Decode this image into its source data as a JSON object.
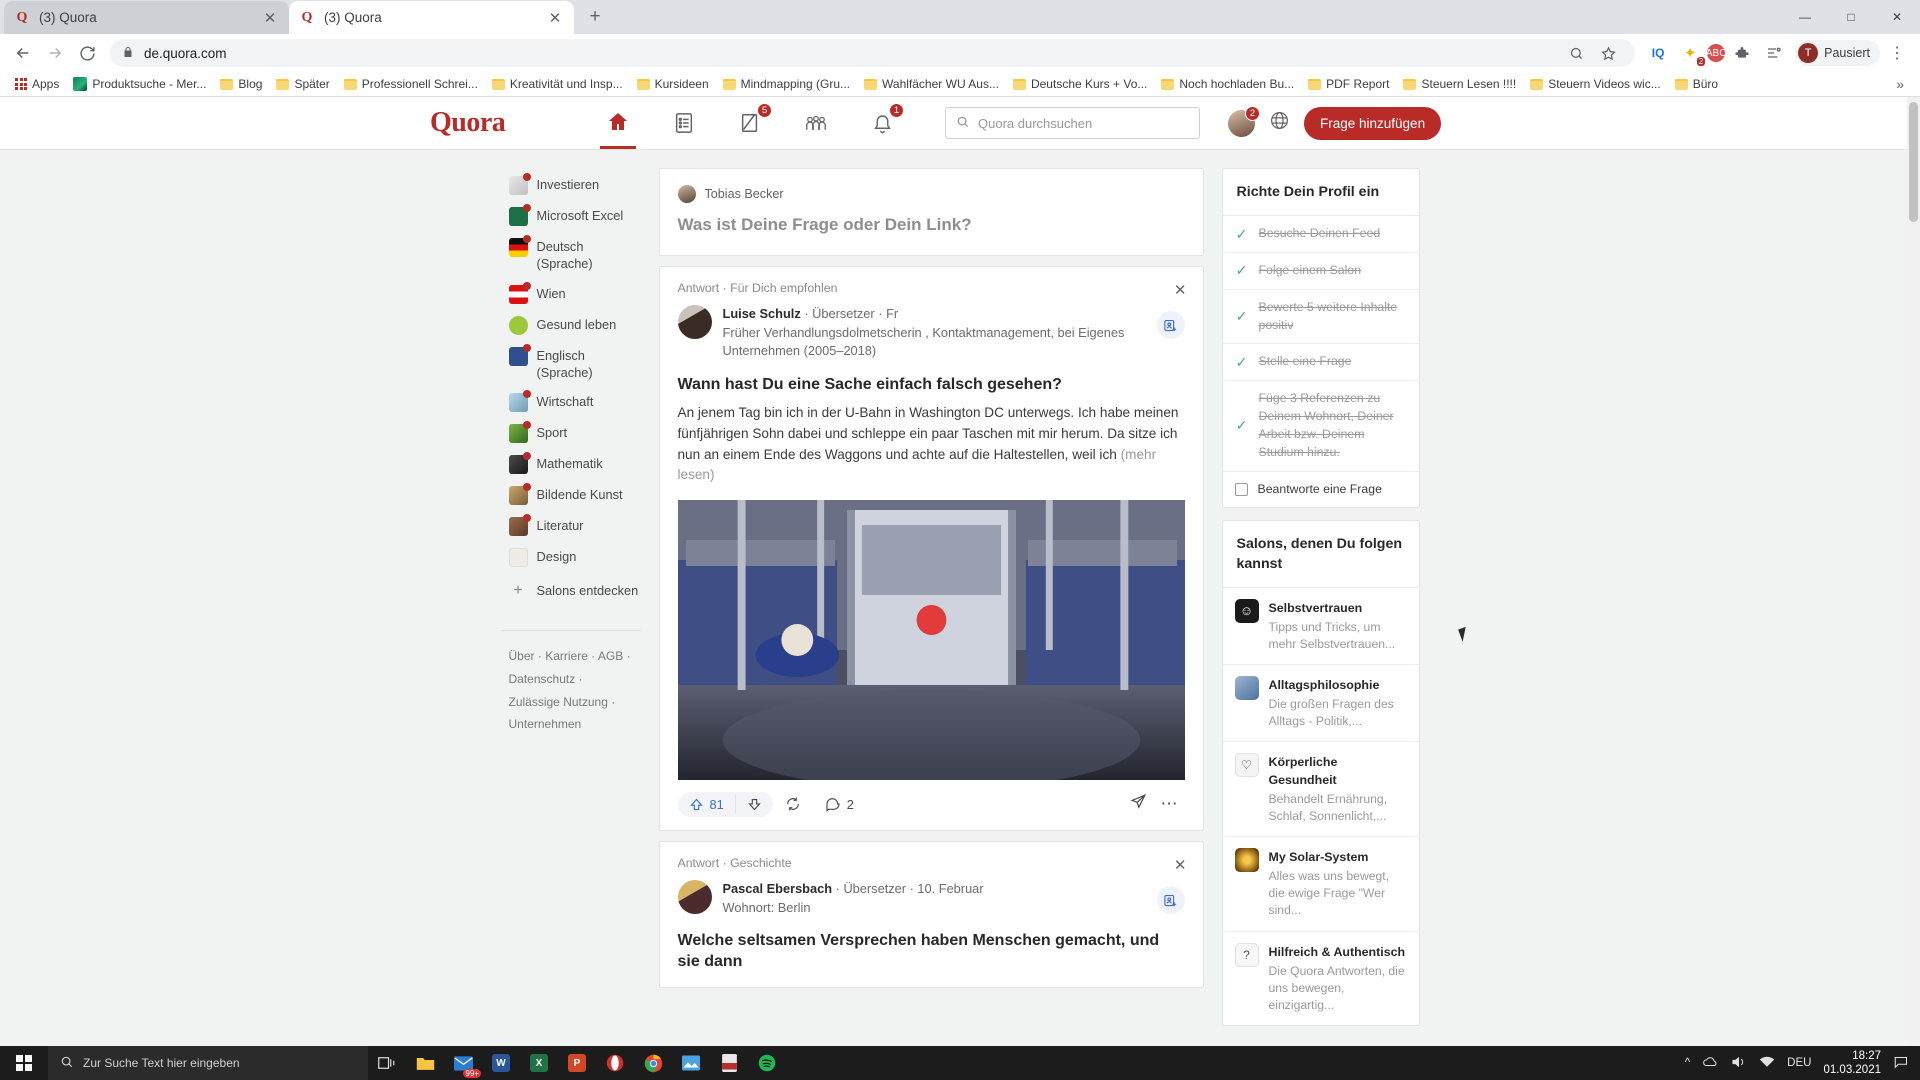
{
  "browser": {
    "tabs": [
      {
        "title": "(3) Quora",
        "favicon": "quora-icon",
        "active": false
      },
      {
        "title": "(3) Quora",
        "favicon": "quora-icon",
        "active": true
      }
    ],
    "newtab_label": "+",
    "window_controls": {
      "minimize": "—",
      "maximize": "□",
      "close": "✕"
    },
    "url": "de.quora.com",
    "profile_label": "Pausiert",
    "profile_initial": "T",
    "bookmarks": [
      {
        "label": "Apps",
        "icon": "apps-grid-icon"
      },
      {
        "label": "Produktsuche - Mer...",
        "icon": "site-icon"
      },
      {
        "label": "Blog",
        "icon": "folder-icon"
      },
      {
        "label": "Später",
        "icon": "folder-icon"
      },
      {
        "label": "Professionell Schrei...",
        "icon": "folder-icon"
      },
      {
        "label": "Kreativität und Insp...",
        "icon": "folder-icon"
      },
      {
        "label": "Kursideen",
        "icon": "folder-icon"
      },
      {
        "label": "Mindmapping  (Gru...",
        "icon": "folder-icon"
      },
      {
        "label": "Wahlfächer WU Aus...",
        "icon": "folder-icon"
      },
      {
        "label": "Deutsche Kurs + Vo...",
        "icon": "folder-icon"
      },
      {
        "label": "Noch hochladen Bu...",
        "icon": "folder-icon"
      },
      {
        "label": "PDF Report",
        "icon": "folder-icon"
      },
      {
        "label": "Steuern Lesen !!!!",
        "icon": "folder-icon"
      },
      {
        "label": "Steuern Videos wic...",
        "icon": "folder-icon"
      },
      {
        "label": "Büro",
        "icon": "folder-icon"
      }
    ],
    "bookmarks_overflow": "»"
  },
  "quora": {
    "logo": "Quora",
    "nav": [
      {
        "name": "home",
        "icon": "home-icon",
        "badge": null,
        "active": true
      },
      {
        "name": "answers",
        "icon": "list-icon",
        "badge": null,
        "active": false
      },
      {
        "name": "write",
        "icon": "pencil-square-icon",
        "badge": "5",
        "active": false
      },
      {
        "name": "spaces",
        "icon": "people-icon",
        "badge": null,
        "active": false
      },
      {
        "name": "notifications",
        "icon": "bell-icon",
        "badge": "1",
        "active": false
      }
    ],
    "search_placeholder": "Quora durchsuchen",
    "avatar_badge": "2",
    "language_icon": "globe-icon",
    "add_question_label": "Frage hinzufügen",
    "accent_color": "#b92b27"
  },
  "sidebar": {
    "topics": [
      {
        "label": "Investieren",
        "dot": true
      },
      {
        "label": "Microsoft Excel",
        "dot": true
      },
      {
        "label": "Deutsch (Sprache)",
        "dot": true
      },
      {
        "label": "Wien",
        "dot": true
      },
      {
        "label": "Gesund leben",
        "dot": false
      },
      {
        "label": "Englisch (Sprache)",
        "dot": true
      },
      {
        "label": "Wirtschaft",
        "dot": true
      },
      {
        "label": "Sport",
        "dot": true
      },
      {
        "label": "Mathematik",
        "dot": true
      },
      {
        "label": "Bildende Kunst",
        "dot": true
      },
      {
        "label": "Literatur",
        "dot": true
      },
      {
        "label": "Design",
        "dot": false
      }
    ],
    "discover_label": "Salons entdecken",
    "footer": [
      "Über",
      "Karriere",
      "AGB",
      "Datenschutz",
      "Zulässige Nutzung",
      "Unternehmen"
    ]
  },
  "ask_box": {
    "user_name": "Tobias Becker",
    "prompt": "Was ist Deine Frage oder Dein Link?"
  },
  "posts": [
    {
      "meta": "Antwort · Für Dich empfohlen",
      "author_name": "Luise Schulz",
      "author_role": "Übersetzer",
      "author_date": "Fr",
      "author_credential": "Früher Verhandlungsdolmetscherin , Kontaktmanagement, bei Eigenes Unternehmen (2005–2018)",
      "title": "Wann hast Du eine Sache einfach falsch gesehen?",
      "body": "An jenem Tag bin ich in der U-Bahn in Washington DC unterwegs. Ich habe meinen fünfjährigen Sohn dabei und schleppe ein paar Taschen mit mir herum. Da sitze ich nun an einem Ende des Waggons und achte auf die Haltestellen, weil ich",
      "more_label": "(mehr lesen)",
      "upvotes": "81",
      "comments": "2",
      "close_label": "✕",
      "has_image": true
    },
    {
      "meta": "Antwort · Geschichte",
      "author_name": "Pascal Ebersbach",
      "author_role": "Übersetzer",
      "author_date": "10. Februar",
      "author_credential": "Wohnort: Berlin",
      "title": "Welche seltsamen Versprechen haben Menschen gemacht, und sie dann",
      "close_label": "✕",
      "has_image": false
    }
  ],
  "profile_setup": {
    "title": "Richte Dein Profil ein",
    "items": [
      {
        "label": "Besuche Deinen Feed",
        "done": true
      },
      {
        "label": "Folge einem Salon",
        "done": true
      },
      {
        "label": "Bewerte 5 weitere Inhalte positiv",
        "done": true
      },
      {
        "label": "Stelle eine Frage",
        "done": true
      },
      {
        "label": "Füge 3 Referenzen zu Deinem Wohnort, Deiner Arbeit bzw. Deinem Studium hinzu.",
        "done": true
      },
      {
        "label": "Beantworte eine Frage",
        "done": false
      }
    ]
  },
  "salons": {
    "title": "Salons, denen Du folgen kannst",
    "items": [
      {
        "name": "Selbstvertrauen",
        "desc": "Tipps und Tricks, um mehr Selbstvertrauen...",
        "icon": "smiley-icon"
      },
      {
        "name": "Alltagsphilosophie",
        "desc": "Die großen Fragen des Alltags - Politik,...",
        "icon": "photo-icon"
      },
      {
        "name": "Körperliche Gesundheit",
        "desc": "Behandelt Ernährung, Schlaf, Sonnenlicht,...",
        "icon": "heart-pulse-icon"
      },
      {
        "name": "My Solar-System",
        "desc": "Alles was uns bewegt, die ewige Frage \"Wer sind...",
        "icon": "sun-icon"
      },
      {
        "name": "Hilfreich & Authentisch",
        "desc": "Die Quora Antworten, die uns bewegen, einzigartig...",
        "icon": "question-icon"
      }
    ]
  },
  "taskbar": {
    "search_placeholder": "Zur Suche Text hier eingeben",
    "apps": [
      {
        "name": "task-view-icon",
        "label": ""
      },
      {
        "name": "file-explorer-icon",
        "label": ""
      },
      {
        "name": "mail-icon",
        "label": "99+"
      },
      {
        "name": "word-icon",
        "label": "W"
      },
      {
        "name": "excel-icon",
        "label": "X"
      },
      {
        "name": "powerpoint-icon",
        "label": "P"
      },
      {
        "name": "opera-icon",
        "label": ""
      },
      {
        "name": "chrome-icon",
        "label": ""
      },
      {
        "name": "photos-icon",
        "label": ""
      },
      {
        "name": "pdf-icon",
        "label": ""
      },
      {
        "name": "spotify-icon",
        "label": ""
      }
    ],
    "tray": {
      "chevron": "∧",
      "onedrive": "☁",
      "volume": "🔊",
      "network": "◴",
      "language": "DEU"
    },
    "time": "18:27",
    "date": "01.03.2021"
  }
}
